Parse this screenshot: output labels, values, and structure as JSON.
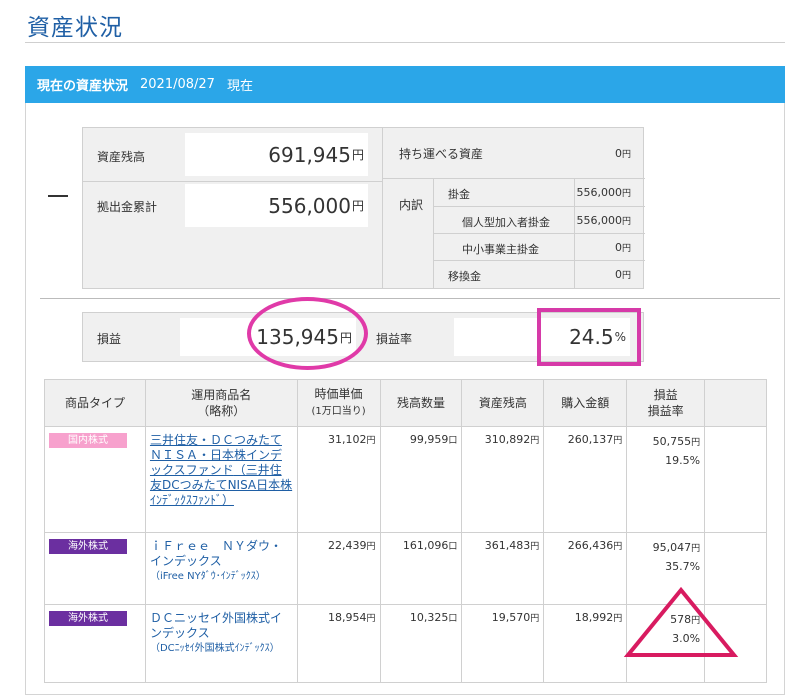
{
  "page": {
    "title": "資産状況"
  },
  "section": {
    "heading": "現在の資産状況",
    "date": "2021/08/27",
    "suffix": "現在"
  },
  "summary": {
    "balance_label": "資産残高",
    "balance_value": "691,945",
    "unit": "円",
    "contrib_label": "拠出金累計",
    "contrib_value": "556,000",
    "portable_label": "持ち運べる資産",
    "portable_value": "0",
    "breakdown_label": "内訳",
    "rows": [
      {
        "label": "掛金",
        "value": "556,000"
      },
      {
        "label": "個人型加入者掛金",
        "value": "556,000"
      },
      {
        "label": "中小事業主掛金",
        "value": "0"
      },
      {
        "label": "移換金",
        "value": "0"
      }
    ],
    "unit_small": "円"
  },
  "profit": {
    "label": "損益",
    "value": "135,945",
    "unit": "円",
    "rate_label": "損益率",
    "rate_value": "24.5",
    "rate_unit": "%"
  },
  "table": {
    "headers": [
      "商品タイプ",
      "運用商品名",
      "（略称）",
      "時価単価",
      "(1万口当り)",
      "残高数量",
      "資産残高",
      "購入金額",
      "損益",
      "損益率"
    ],
    "rows": [
      {
        "type": "国内株式",
        "name": "三井住友・ＤＣつみたてＮＩＳＡ・日本株インデックスファンド",
        "short": "（三井住友DCつみたてNISA日本株ｲﾝﾃﾞｯｸｽﾌｧﾝﾄﾞ）",
        "price": "31,102",
        "qty": "99,959",
        "balance": "310,892",
        "cost": "260,137",
        "pl": "50,755",
        "rate": "19.5%"
      },
      {
        "type": "海外株式",
        "name": "ｉＦｒｅｅ　ＮＹダウ・インデックス",
        "short": "（iFree NYﾀﾞｳ･ｲﾝﾃﾞｯｸｽ）",
        "price": "22,439",
        "qty": "161,096",
        "balance": "361,483",
        "cost": "266,436",
        "pl": "95,047",
        "rate": "35.7%"
      },
      {
        "type": "海外株式",
        "name": "ＤＣニッセイ外国株式インデックス",
        "short": "（DCﾆｯｾｲ外国株式ｲﾝﾃﾞｯｸｽ）",
        "price": "18,954",
        "qty": "10,325",
        "balance": "19,570",
        "cost": "18,992",
        "pl": "578",
        "rate": "3.0%"
      }
    ],
    "yen": "円",
    "kuchi": "口"
  }
}
